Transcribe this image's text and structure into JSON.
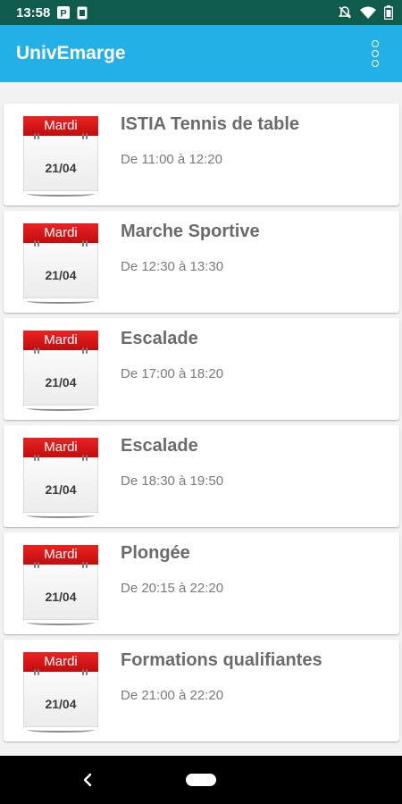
{
  "status_bar": {
    "time": "13:58",
    "icons_left": [
      "parking-icon",
      "sim-card-icon"
    ],
    "icons_right": [
      "notifications-off-icon",
      "wifi-icon",
      "battery-icon"
    ]
  },
  "app_bar": {
    "title": "UnivEmarge",
    "menu_icon": "more-vert-icon"
  },
  "colors": {
    "status_bar": "#0f5c4d",
    "app_bar": "#23b0e6",
    "calendar_header": "#d71818",
    "background": "#f2f2f2"
  },
  "events": [
    {
      "day": "Mardi",
      "date": "21/04",
      "title": "ISTIA Tennis de table",
      "time": "De 11:00 à 12:20"
    },
    {
      "day": "Mardi",
      "date": "21/04",
      "title": "Marche Sportive",
      "time": "De 12:30 à 13:30"
    },
    {
      "day": "Mardi",
      "date": "21/04",
      "title": "Escalade",
      "time": "De 17:00 à 18:20"
    },
    {
      "day": "Mardi",
      "date": "21/04",
      "title": "Escalade",
      "time": "De 18:30 à 19:50"
    },
    {
      "day": "Mardi",
      "date": "21/04",
      "title": "Plongée",
      "time": "De 20:15 à 22:20"
    },
    {
      "day": "Mardi",
      "date": "21/04",
      "title": "Formations qualifiantes",
      "time": "De 21:00 à 22:20"
    }
  ],
  "nav_bar": {
    "back_icon": "back-chevron-icon",
    "home_icon": "home-pill-icon"
  }
}
